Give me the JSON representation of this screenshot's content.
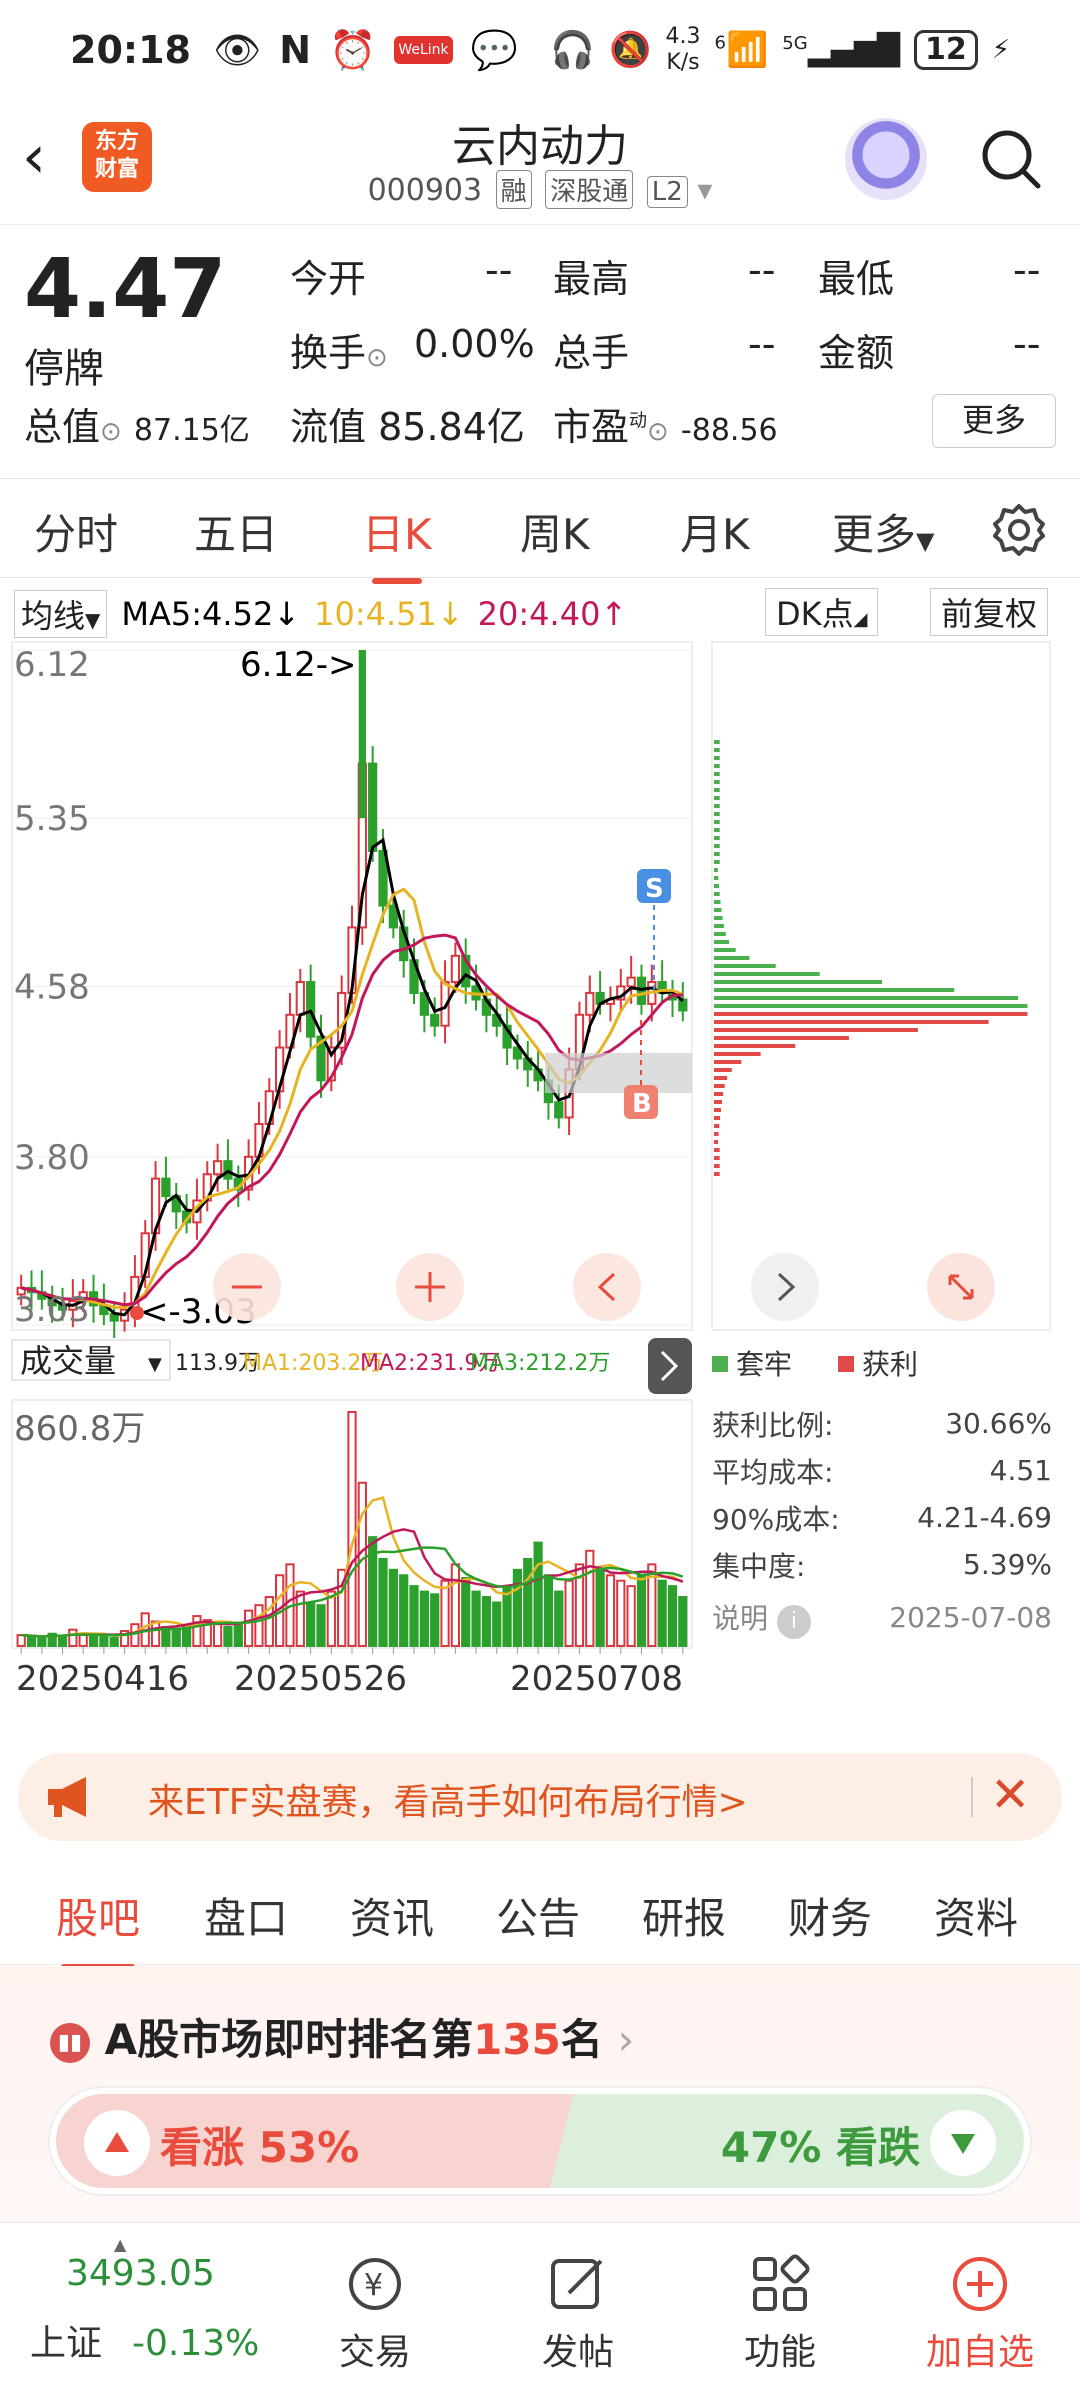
{
  "status_bar": {
    "time": "20:18",
    "net_speed_value": "4.3",
    "net_speed_unit": "K/s",
    "battery": "12",
    "welink": "WeLink",
    "wifi_label": "6",
    "signal_label": "5G"
  },
  "header": {
    "title": "云内动力",
    "code": "000903",
    "tags": [
      "融",
      "深股通",
      "L2"
    ],
    "logo_line1": "东方",
    "logo_line2": "财富"
  },
  "quote": {
    "price": "4.47",
    "status": "停牌",
    "open_label": "今开",
    "open": "--",
    "high_label": "最高",
    "high": "--",
    "low_label": "最低",
    "low": "--",
    "turnover_label": "换手",
    "turnover": "0.00%",
    "volume_label": "总手",
    "volume": "--",
    "amount_label": "金额",
    "amount": "--",
    "mcap_label": "总值",
    "mcap": "87.15亿",
    "float_label": "流值",
    "float": "85.84亿",
    "pe_label": "市盈",
    "pe_sup": "动",
    "pe": "-88.56",
    "more": "更多"
  },
  "period_tabs": [
    "分时",
    "五日",
    "日K",
    "周K",
    "月K",
    "更多"
  ],
  "ma_bar": {
    "select": "均线",
    "ma5": "MA5:4.52",
    "ma10": "10:4.51",
    "ma20": "20:4.40",
    "dk": "DK点",
    "adj": "前复权"
  },
  "chart_data": {
    "type": "candlestick",
    "y_ticks": [
      "6.12",
      "5.35",
      "4.58",
      "3.80",
      "3.03"
    ],
    "ylim": [
      3.03,
      6.12
    ],
    "high_annotation": "6.12->",
    "low_annotation": "<-3.03",
    "buy_marker": "B",
    "sell_marker": "S",
    "close": [
      3.2,
      3.18,
      3.15,
      3.12,
      3.1,
      3.14,
      3.18,
      3.12,
      3.08,
      3.05,
      3.1,
      3.25,
      3.45,
      3.7,
      3.62,
      3.55,
      3.5,
      3.6,
      3.72,
      3.78,
      3.7,
      3.65,
      3.8,
      3.95,
      4.1,
      4.3,
      4.45,
      4.6,
      4.35,
      4.15,
      4.3,
      4.55,
      4.85,
      5.6,
      5.2,
      4.95,
      4.85,
      4.7,
      4.55,
      4.45,
      4.4,
      4.6,
      4.72,
      4.58,
      4.52,
      4.45,
      4.4,
      4.3,
      4.25,
      4.2,
      4.15,
      4.05,
      3.98,
      4.2,
      4.45,
      4.55,
      4.5,
      4.52,
      4.58,
      4.62,
      4.5,
      4.6,
      4.55,
      4.52,
      4.47
    ],
    "volume_label": "成交量",
    "volume_info": "113.9万",
    "vma1": "MA1:203.2万",
    "vma2": "MA2:231.9万",
    "vma3": "MA3:212.2万",
    "volume_max": "860.8万",
    "dates": [
      "20250416",
      "20250526",
      "20250708"
    ],
    "volumes": [
      40,
      35,
      30,
      45,
      38,
      60,
      45,
      40,
      35,
      30,
      55,
      80,
      120,
      90,
      70,
      60,
      75,
      110,
      95,
      80,
      70,
      85,
      130,
      150,
      180,
      260,
      300,
      200,
      160,
      150,
      200,
      280,
      860,
      600,
      400,
      320,
      280,
      260,
      220,
      200,
      190,
      240,
      300,
      250,
      200,
      180,
      160,
      220,
      280,
      320,
      380,
      260,
      200,
      240,
      300,
      350,
      280,
      260,
      240,
      220,
      260,
      300,
      240,
      220,
      180
    ]
  },
  "chip_panel": {
    "legend_trapped": "套牢",
    "legend_profit": "获利",
    "rows": [
      {
        "label": "获利比例:",
        "value": "30.66%"
      },
      {
        "label": "平均成本:",
        "value": "4.51"
      },
      {
        "label": "90%成本:",
        "value": "4.21-4.69"
      },
      {
        "label": "集中度:",
        "value": "5.39%"
      }
    ],
    "note": "说明",
    "date": "2025-07-08"
  },
  "banner": {
    "text": "来ETF实盘赛，看高手如何布局行情>"
  },
  "bottom_tabs": [
    "股吧",
    "盘口",
    "资讯",
    "公告",
    "研报",
    "财务",
    "资料"
  ],
  "rank": {
    "prefix": "A股市场即时排名第",
    "num": "135",
    "suffix": "名"
  },
  "vote": {
    "up": "看涨 53%",
    "down": "47% 看跌"
  },
  "nav": {
    "index_value": "3493.05",
    "index_name": "上证",
    "index_change": "-0.13%",
    "items": [
      "交易",
      "发帖",
      "功能",
      "加自选"
    ]
  },
  "colors": {
    "up": "#d9363e",
    "down": "#2ca02c",
    "ma5": "#000000",
    "ma10": "#e6b422",
    "ma20": "#c2185b",
    "accent": "#e94b3c"
  }
}
